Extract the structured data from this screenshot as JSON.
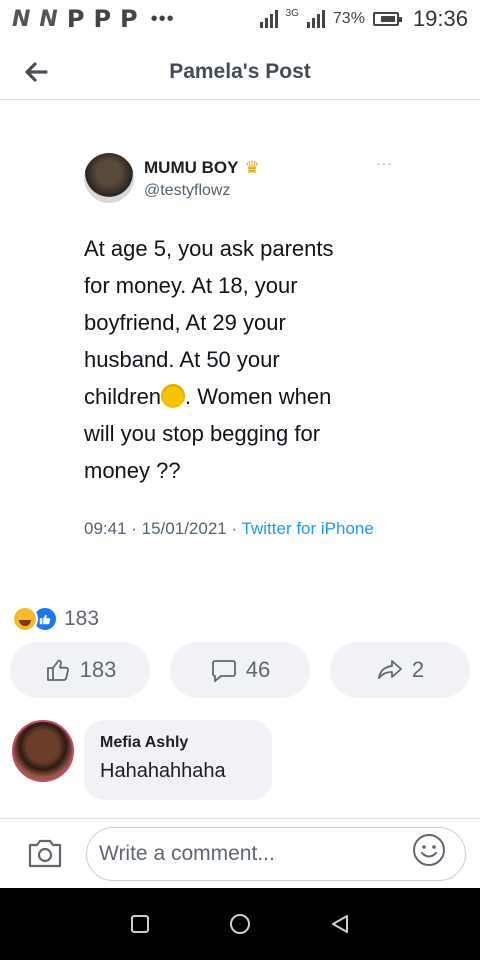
{
  "status_bar": {
    "glyphs": [
      "N",
      "N",
      "P",
      "P",
      "P"
    ],
    "dots": "•••",
    "network": "3G",
    "battery_pct": "73%",
    "time": "19:36"
  },
  "header": {
    "title": "Pamela's Post"
  },
  "tweet": {
    "name": "MUMU BOY",
    "handle": "@testyflowz",
    "more": "···",
    "body_lines": [
      "At age 5, you ask parents",
      "for money. At 18, your",
      "boyfriend, At 29 your",
      "husband. At 50 your"
    ],
    "body_children": "children",
    "body_after_emoji": ". Women when",
    "body_lines_end": [
      "will you stop begging for",
      "money ??"
    ],
    "meta_time": "09:41 · 15/01/2021 · ",
    "meta_source": "Twitter for iPhone"
  },
  "reactions": {
    "count": "183"
  },
  "actions": {
    "like_count": "183",
    "comment_count": "46",
    "share_count": "2"
  },
  "comment": {
    "author": "Mefia Ashly",
    "text": "Hahahahhaha"
  },
  "composer": {
    "placeholder": "Write a comment..."
  },
  "colors": {
    "like_blue": "#1877f2",
    "link_blue": "#1d9bf0",
    "bubble_bg": "#f0f2f5"
  }
}
